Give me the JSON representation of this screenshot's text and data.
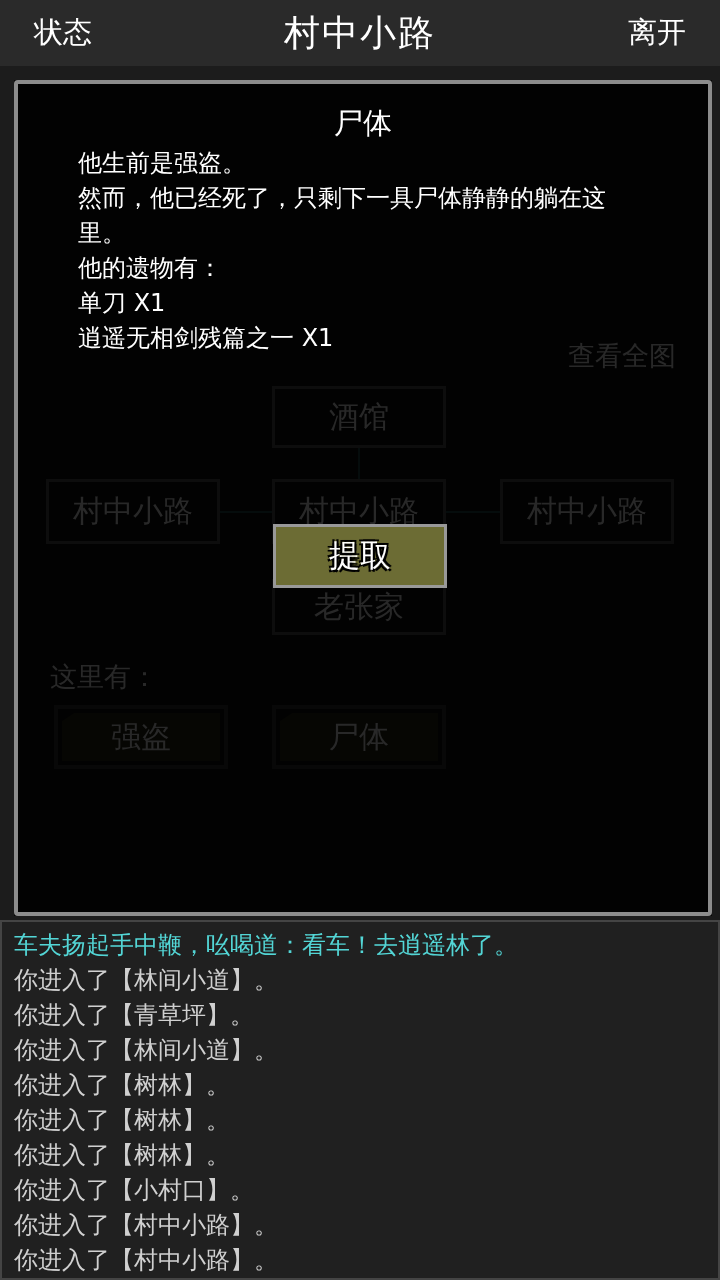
{
  "header": {
    "left_button": "状态",
    "title": "村中小路",
    "right_button": "离开"
  },
  "scene": {
    "full_map_link": "查看全图",
    "map": {
      "north": "酒馆",
      "west": "村中小路",
      "center": "村中小路",
      "east": "村中小路",
      "south": "老张家"
    },
    "here_label": "这里有：",
    "entities": [
      "强盗",
      "尸体"
    ]
  },
  "dialog": {
    "title": "尸体",
    "lines": [
      "他生前是强盗。",
      "然而，他已经死了，只剩下一具尸体静静的躺在这里。",
      "他的遗物有：",
      "单刀 X1",
      "逍遥无相剑残篇之一 X1"
    ],
    "button": "提取"
  },
  "log": [
    {
      "text": "车夫扬起手中鞭，吆喝道：看车！去逍遥林了。",
      "kind": "speech"
    },
    {
      "text": "你进入了【林间小道】。",
      "kind": "move"
    },
    {
      "text": "你进入了【青草坪】。",
      "kind": "move"
    },
    {
      "text": "你进入了【林间小道】。",
      "kind": "move"
    },
    {
      "text": "你进入了【树林】。",
      "kind": "move"
    },
    {
      "text": "你进入了【树林】。",
      "kind": "move"
    },
    {
      "text": "你进入了【树林】。",
      "kind": "move"
    },
    {
      "text": "你进入了【小村口】。",
      "kind": "move"
    },
    {
      "text": "你进入了【村中小路】。",
      "kind": "move"
    },
    {
      "text": "你进入了【村中小路】。",
      "kind": "move"
    }
  ]
}
